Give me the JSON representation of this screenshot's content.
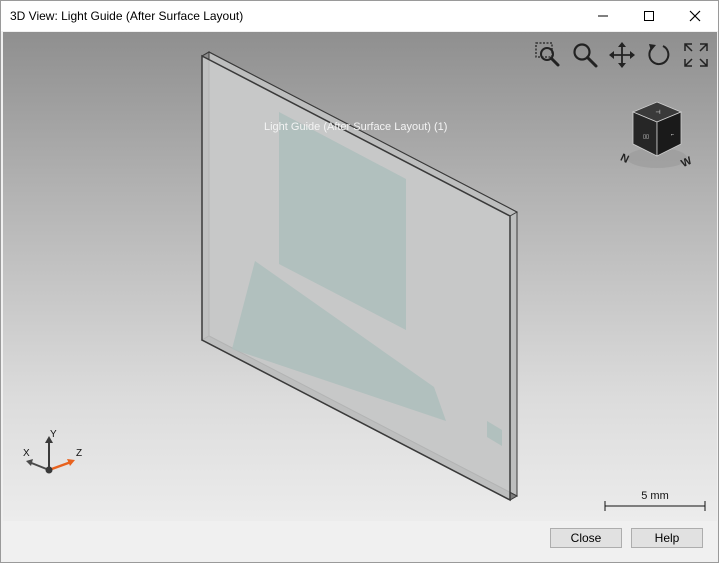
{
  "window": {
    "title": "3D View: Light Guide (After Surface Layout)"
  },
  "titlebar_icons": [
    "minimize-icon",
    "maximize-icon",
    "close-icon"
  ],
  "viewport": {
    "object_label": "Light Guide (After Surface Layout) (1)",
    "toolbar_icons": [
      "zoom-window-icon",
      "zoom-icon",
      "pan-icon",
      "rotate-icon",
      "fit-all-icon"
    ],
    "viewcube": {
      "faces": [
        "top",
        "front",
        "right"
      ],
      "compass": [
        "N",
        "W"
      ]
    },
    "triad": {
      "x_label": "X",
      "y_label": "Y",
      "z_label": "Z"
    },
    "scale": {
      "label": "5 mm"
    },
    "colors": {
      "panel_fill": "#c9caca",
      "panel_edge": "#3a3a3a",
      "pattern_fill": "#aebfbd",
      "axis_z": "#e8621e"
    }
  },
  "footer": {
    "close_label": "Close",
    "help_label": "Help"
  }
}
